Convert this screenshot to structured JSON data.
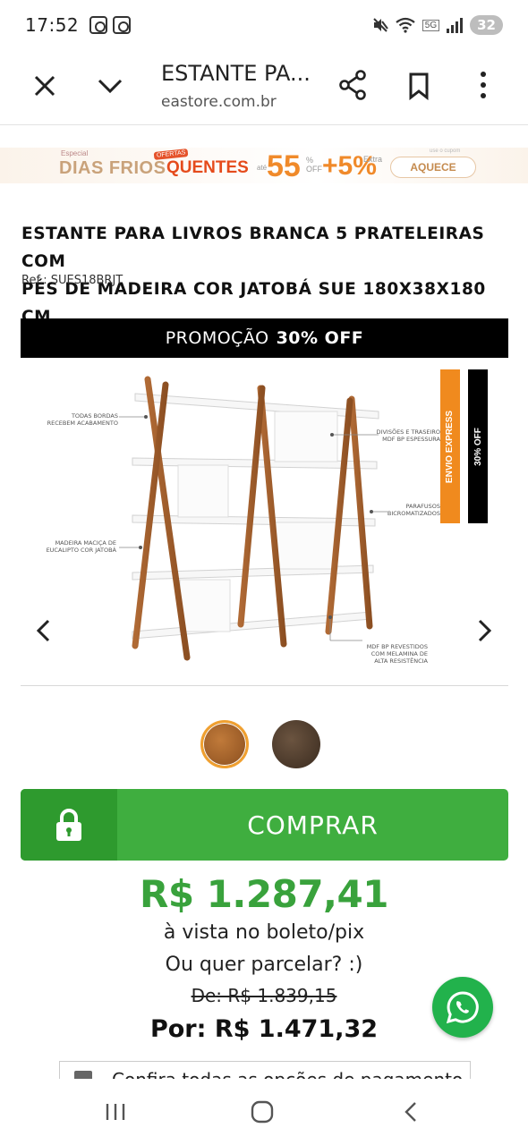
{
  "status_bar": {
    "time": "17:52",
    "network": "5G",
    "battery": "32"
  },
  "browser": {
    "title": "ESTANTE PA...",
    "url": "eastore.com.br",
    "icons": [
      "close-icon",
      "chevron-down-icon",
      "share-icon",
      "bookmark-icon",
      "more-vert-icon"
    ]
  },
  "promo_banner": {
    "especial": "Especial",
    "dias_frios": "DIAS FRIOS",
    "ofertas": "OFERTAS",
    "quentes": "QUENTES",
    "ate": "até",
    "discount": "55",
    "off_small": "%\nOFF",
    "extra_discount": "+5%",
    "extra": "Extra",
    "cupom": "use o cupom",
    "coupon": "AQUECE"
  },
  "product": {
    "title_line1": "ESTANTE PARA LIVROS BRANCA 5 PRATELEIRAS COM",
    "title_line2": "PÉS DE MADEIRA COR JATOBÁ SUE 180X38X180 CM",
    "ref": "Ref.: SUES18BRJT",
    "promo_strip_text": "PROMOÇÃO",
    "promo_strip_bold": "30% OFF",
    "image_tags": {
      "envio": "ENVIO EXPRESS",
      "off": "30% OFF"
    },
    "annotations": {
      "a1_line1": "TODAS BORDAS",
      "a1_line2": "RECEBEM ACABAMENTO",
      "a2_line1": "DIVISÕES E TRASEIRO",
      "a2_line2": "MDF BP ESPESSURA",
      "a3_line1": "PARAFUSOS",
      "a3_line2": "BICROMATIZADOS",
      "a4_line1": "MADEIRA MACIÇA DE",
      "a4_line2": "EUCALIPTO COR JATOBÁ",
      "a5_line1": "MDF BP REVESTIDOS",
      "a5_line2": "COM MELAMINA DE",
      "a5_line3": "ALTA RESISTÊNCIA"
    },
    "swatches": [
      {
        "name": "Jatobá",
        "color": "#a8642a",
        "selected": true
      },
      {
        "name": "Escuro",
        "color": "#4e3b2b",
        "selected": false
      }
    ]
  },
  "buy": {
    "label": "COMPRAR",
    "color": "#3fae3f"
  },
  "pricing": {
    "main_price": "R$ 1.287,41",
    "method": "à vista no boleto/pix",
    "installments": "Ou quer parcelar? :)",
    "old_price": "De: R$ 1.839,15",
    "new_price": "Por: R$ 1.471,32"
  },
  "payment_options": {
    "text": "Confira todas as opções de pagamento"
  },
  "whatsapp": {
    "icon": "whatsapp-icon"
  },
  "nav": {
    "icons": [
      "recents-icon",
      "home-icon",
      "back-icon"
    ]
  }
}
